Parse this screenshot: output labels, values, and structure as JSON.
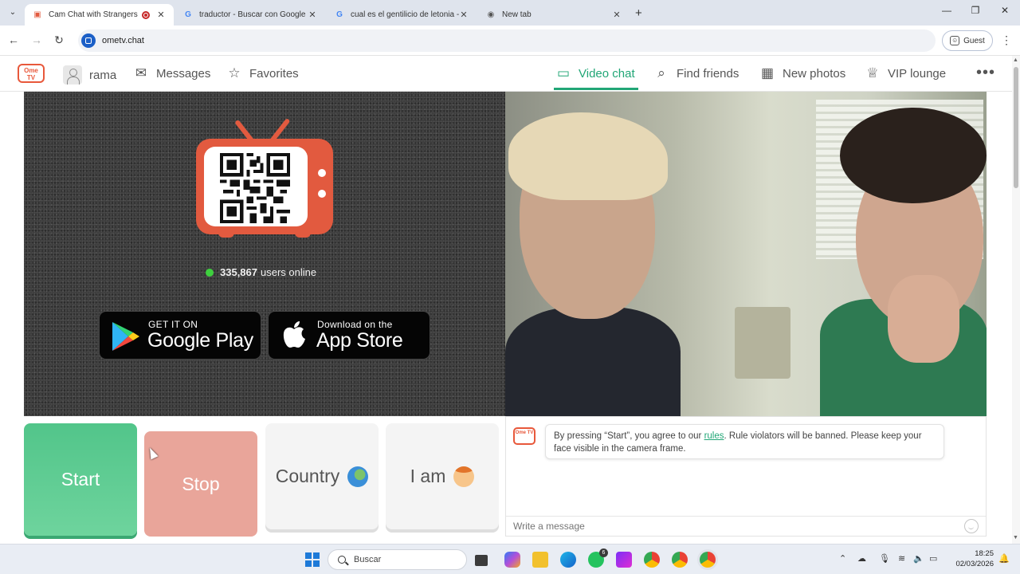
{
  "browser": {
    "tabs": [
      {
        "title": "Cam Chat with Strangers on",
        "favicon": "ometv-icon",
        "recording": true,
        "active": true
      },
      {
        "title": "traductor - Buscar con Google",
        "favicon": "google-icon",
        "active": false
      },
      {
        "title": "cual es el gentilicio de letonia -",
        "favicon": "google-icon",
        "active": false
      },
      {
        "title": "New tab",
        "favicon": "chrome-icon",
        "active": false
      }
    ],
    "url": "ometv.chat",
    "profile_label": "Guest"
  },
  "header": {
    "logo_text": "Ome TV",
    "username": "rama",
    "nav_left": [
      {
        "label": "Messages",
        "icon": "envelope-icon"
      },
      {
        "label": "Favorites",
        "icon": "star-icon"
      }
    ],
    "nav_right": [
      {
        "label": "Video chat",
        "icon": "tv-icon",
        "active": true
      },
      {
        "label": "Find friends",
        "icon": "magnifier-icon"
      },
      {
        "label": "New photos",
        "icon": "photo-icon"
      },
      {
        "label": "VIP lounge",
        "icon": "crown-icon"
      }
    ],
    "more_label": "•••"
  },
  "promo": {
    "users_count": "335,867",
    "users_label": "users online",
    "google_play": {
      "line1": "GET IT ON",
      "line2": "Google Play"
    },
    "app_store": {
      "line1": "Download on the",
      "line2": "App Store"
    }
  },
  "controls": {
    "start": "Start",
    "stop": "Stop",
    "country": "Country",
    "country_icon": "globe-icon",
    "iam": "I am",
    "iam_icon": "person-face-icon"
  },
  "chat": {
    "logo_text": "Ome TV",
    "message_before": "By pressing “Start”, you agree to our ",
    "message_link": "rules",
    "message_after": ". Rule violators will be banned. Please keep your face visible in the camera frame.",
    "input_placeholder": "Write a message"
  },
  "taskbar": {
    "search_placeholder": "Buscar",
    "whatsapp_badge": "6",
    "time": "18:25",
    "date": "02/03/2026"
  },
  "colors": {
    "accent_green": "#21a676",
    "start_green": "#52c58a",
    "stop_salmon": "#e9a59a",
    "brand_orange": "#e25a3f"
  }
}
